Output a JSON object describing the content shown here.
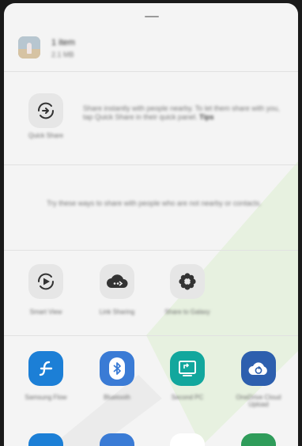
{
  "header": {
    "title": "1 item",
    "subtitle": "2.1 MB"
  },
  "smart_share": {
    "label": "Quick Share",
    "description": "Share instantly with people nearby. To let them share with you, tap Quick Share in their quick panel.",
    "link": "Tips"
  },
  "nearby_hint": "Try these ways to share with people who are not nearby or contacts.",
  "row_share": [
    {
      "label": "Smart View",
      "icon": "smart-view-icon"
    },
    {
      "label": "Link Sharing",
      "icon": "cloud-link-icon"
    },
    {
      "label": "Share to Galaxy",
      "icon": "flower-icon"
    }
  ],
  "row_apps": [
    {
      "label": "Samsung Flow",
      "icon": "samsung-flow-icon",
      "color": "#1c7fd6"
    },
    {
      "label": "Bluetooth",
      "icon": "bluetooth-icon",
      "color": "#3a7bd5"
    },
    {
      "label": "Second PC",
      "icon": "second-screen-icon",
      "color": "#12a79d"
    },
    {
      "label": "OneDrive Cloud Upload",
      "icon": "cloud-sync-icon",
      "color": "#2d5fae"
    }
  ],
  "row_bottom": [
    {
      "icon": "app-blue-icon",
      "color": "#1c7fd6"
    },
    {
      "icon": "app-screen-icon",
      "color": "#3a7bd5"
    },
    {
      "icon": "app-white-icon",
      "color": "#ffffff"
    },
    {
      "icon": "app-green-icon",
      "color": "#2f9c5a"
    }
  ],
  "colors": {
    "watermark_green": "#d7efc7",
    "watermark_gray": "#ececec"
  }
}
